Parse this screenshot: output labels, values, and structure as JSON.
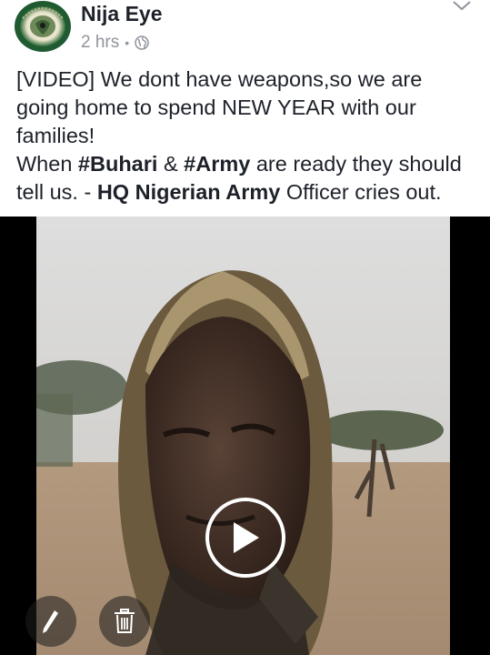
{
  "post": {
    "author": "Nija Eye",
    "time": "2 hrs",
    "separator": "•",
    "privacy_icon": "globe-icon",
    "options_icon": "chevron-down-icon",
    "avatar_icon": "nija-eye-logo"
  },
  "text": {
    "line1_prefix": "[VIDEO] We dont have weapons,so we are going home to spend NEW YEAR with our families!",
    "line2_a": "When ",
    "hashtag1": "#Buhari",
    "line2_b": " & ",
    "hashtag2": "#Army",
    "line2_c": " are ready they should tell us. - ",
    "bold_org": "HQ Nigerian Army",
    "line2_d": " Officer cries out."
  },
  "video": {
    "play_icon": "play-icon",
    "edit_icon": "pencil-icon",
    "delete_icon": "trash-icon"
  },
  "colors": {
    "text": "#1d2129",
    "meta": "#90949c",
    "video_bg": "#000000"
  }
}
